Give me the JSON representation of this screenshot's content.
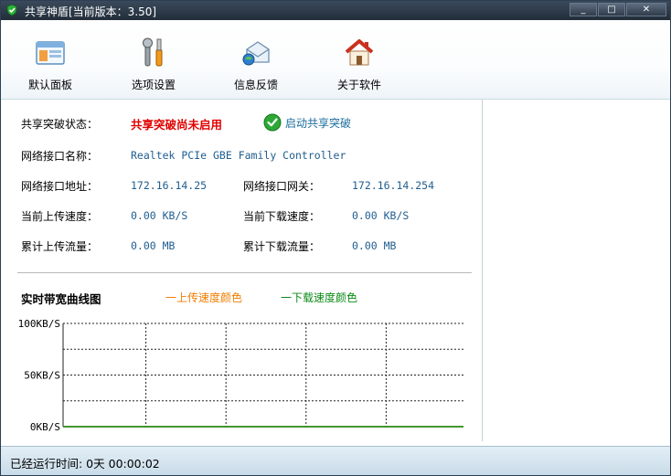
{
  "window": {
    "title": "共享神盾[当前版本：3.50]",
    "buttons": {
      "minimize": "_",
      "maximize": "□",
      "close": "✕"
    }
  },
  "toolbar": {
    "items": [
      {
        "label": "默认面板",
        "icon": "panel-icon"
      },
      {
        "label": "选项设置",
        "icon": "tools-icon"
      },
      {
        "label": "信息反馈",
        "icon": "feedback-mail-icon"
      },
      {
        "label": "关于软件",
        "icon": "home-icon"
      }
    ]
  },
  "status": {
    "share_state_label": "共享突破状态：",
    "share_state_value": "共享突破尚未启用",
    "enable_button": "启动共享突破",
    "iface_name_label": "网络接口名称：",
    "iface_name_value": "Realtek PCIe GBE Family Controller",
    "iface_addr_label": "网络接口地址：",
    "iface_addr_value": "172.16.14.25",
    "iface_gw_label": "网络接口网关：",
    "iface_gw_value": "172.16.14.254",
    "up_speed_label": "当前上传速度：",
    "up_speed_value": "0.00 KB/S",
    "down_speed_label": "当前下载速度：",
    "down_speed_value": "0.00 KB/S",
    "up_total_label": "累计上传流量：",
    "up_total_value": "0.00 MB",
    "down_total_label": "累计下载流量：",
    "down_total_value": "0.00 MB"
  },
  "chart": {
    "title": "实时带宽曲线图",
    "legend_up": "一上传速度颜色",
    "legend_down": "一下载速度颜色",
    "colors": {
      "up": "#f07d00",
      "down": "#0b8a16"
    }
  },
  "chart_data": {
    "type": "line",
    "title": "实时带宽曲线图",
    "ylabel": "",
    "xlabel": "",
    "ylim": [
      0,
      100
    ],
    "yticks": [
      "100KB/S",
      "50KB/S",
      "0KB/S"
    ],
    "grid": true,
    "series": [
      {
        "name": "一上传速度颜色",
        "values": [
          0,
          0
        ],
        "color": "#f07d00"
      },
      {
        "name": "一下载速度颜色",
        "values": [
          0,
          0
        ],
        "color": "#0b8a16"
      }
    ]
  },
  "statusbar": {
    "text": "已经运行时间: 0天 00:00:02"
  }
}
